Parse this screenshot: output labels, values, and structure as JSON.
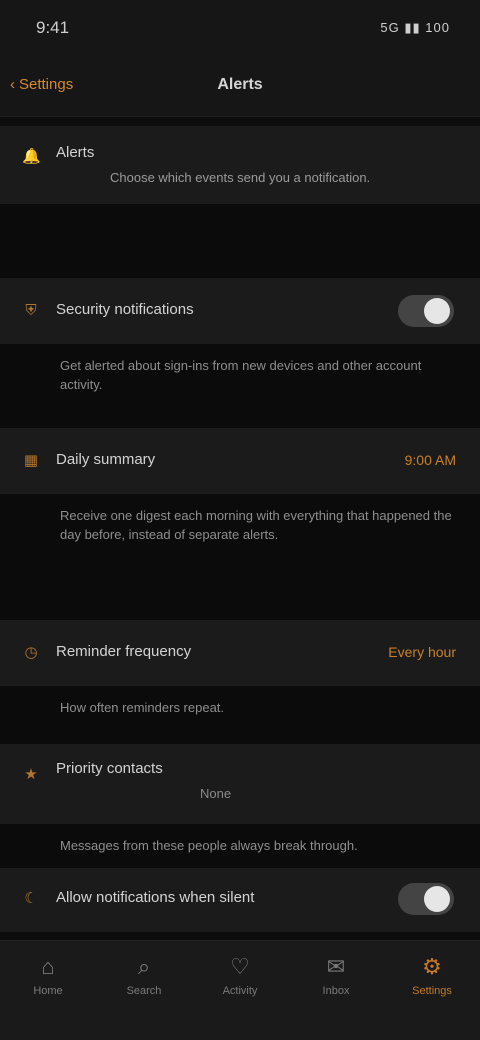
{
  "status_bar": {
    "time": "9:41",
    "system": "5G ▮▮ 100"
  },
  "nav": {
    "back_label": "Settings",
    "title": "Alerts"
  },
  "sections": [
    {
      "icon": "bell-icon",
      "glyph": "🔔",
      "label": "Alerts",
      "desc": "Choose which events send you a notification."
    },
    {
      "icon": "shield-icon",
      "glyph": "⛨",
      "label": "Security notifications",
      "toggle": "on",
      "desc": "Get alerted about sign-ins from new devices and other account activity."
    },
    {
      "icon": "calendar-icon",
      "glyph": "▦",
      "label": "Daily summary",
      "value": "9:00 AM",
      "desc": "Receive one digest each morning with everything that happened the day before, instead of separate alerts."
    },
    {
      "icon": "clock-icon",
      "glyph": "◷",
      "label": "Reminder frequency",
      "value": "Every hour",
      "desc": "How often reminders repeat."
    },
    {
      "icon": "star-icon",
      "glyph": "★",
      "label": "Priority contacts",
      "sublabel": "None",
      "desc": "Messages from these people always break through."
    },
    {
      "icon": "moon-icon",
      "glyph": "☾",
      "label": "Allow notifications when silent",
      "toggle": "on"
    }
  ],
  "tabs": [
    {
      "label": "Home",
      "glyph": "⌂",
      "icon": "home-icon"
    },
    {
      "label": "Search",
      "glyph": "⌕",
      "icon": "search-icon"
    },
    {
      "label": "Activity",
      "glyph": "♡",
      "icon": "heart-icon"
    },
    {
      "label": "Inbox",
      "glyph": "✉",
      "icon": "mail-icon"
    },
    {
      "label": "Settings",
      "glyph": "⚙",
      "icon": "gear-icon",
      "active": true
    }
  ]
}
